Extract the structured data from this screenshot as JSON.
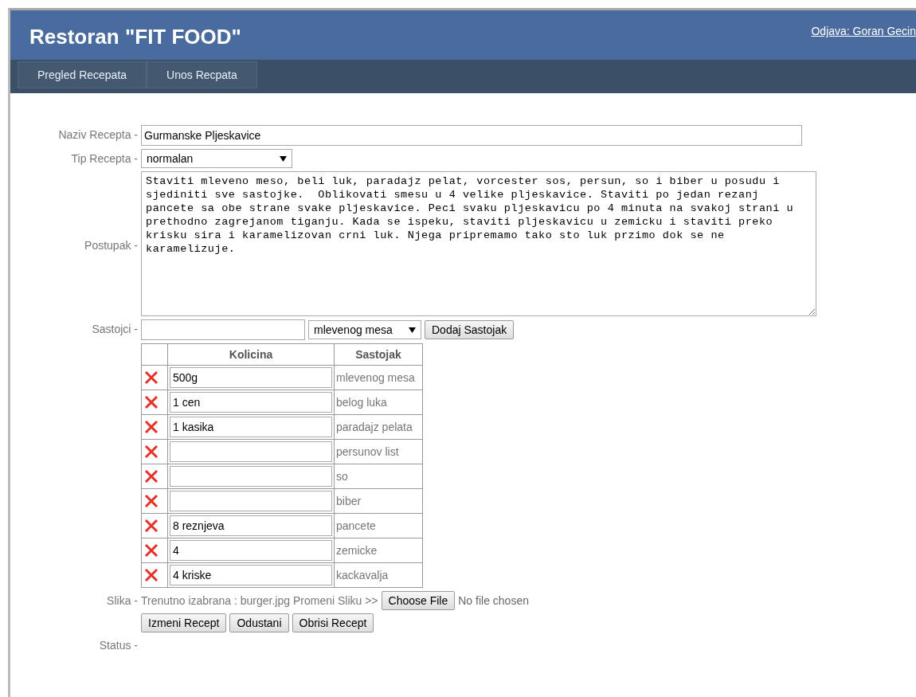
{
  "header": {
    "title": "Restoran \"FIT FOOD\"",
    "logout_link": "Odjava: Goran Gecin"
  },
  "nav": [
    {
      "label": "Pregled Recepata",
      "selected": false
    },
    {
      "label": "Unos Recpata",
      "selected": false
    }
  ],
  "form": {
    "name_label": "Naziv Recepta -",
    "name_value": "Gurmanske Pljeskavice",
    "type_label": "Tip Recepta -",
    "type_value": "normalan",
    "steps_label": "Postupak -",
    "steps_value": "Staviti mleveno meso, beli luk, paradajz pelat, vorcester sos, persun, so i biber u posudu i sjediniti sve sastojke.  Oblikovati smesu u 4 velike pljeskavice. Staviti po jedan rezanj pancete sa obe strane svake pljeskavice. Peci svaku pljeskavicu po 4 minuta na svakoj strani u prethodno zagrejanom tiganju. Kada se ispeku, staviti pljeskavicu u zemicku i staviti preko krisku sira i karamelizovan crni luk. Njega pripremamo tako sto luk przimo dok se ne karamelizuje.",
    "ingredients_label": "Sastojci -",
    "ingredient_select": "mlevenog mesa",
    "add_button": "Dodaj Sastojak",
    "table": {
      "columns": [
        "Kolicina",
        "Sastojak"
      ],
      "rows": [
        {
          "amount": "500g",
          "ingredient": "mlevenog mesa"
        },
        {
          "amount": "1 cen",
          "ingredient": "belog luka"
        },
        {
          "amount": "1 kasika",
          "ingredient": "paradajz pelata"
        },
        {
          "amount": "",
          "ingredient": "persunov list"
        },
        {
          "amount": "",
          "ingredient": "so"
        },
        {
          "amount": "",
          "ingredient": "biber"
        },
        {
          "amount": "8 reznjeva",
          "ingredient": "pancete"
        },
        {
          "amount": "4",
          "ingredient": "zemicke"
        },
        {
          "amount": "4 kriske",
          "ingredient": "kackavalja"
        }
      ]
    },
    "image_label": "Slika -",
    "image_text": "Trenutno izabrana : burger.jpg Promeni Sliku >>",
    "file_button": "Choose File",
    "file_status": "No file chosen",
    "buttons": [
      "Izmeni Recept",
      "Odustani",
      "Obrisi Recept"
    ],
    "status_label": "Status -"
  }
}
